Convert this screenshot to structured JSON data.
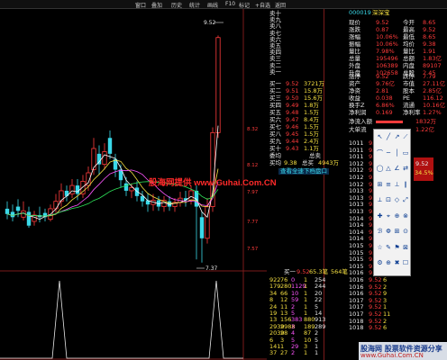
{
  "toolbar": {
    "items": [
      "窗口",
      "叠加",
      "历史",
      "统计",
      "画线",
      "F10",
      "标记",
      "+自选",
      "返回"
    ]
  },
  "chart": {
    "top_price": "9.52",
    "bottom_price": "7.37",
    "price_axis_labels": [
      "8.32",
      "8.12",
      "7.97",
      "7.77",
      "7.57"
    ],
    "watermark": "股海网提供 www.Guhai.Com.CN"
  },
  "ask_labels": [
    "卖十",
    "卖九",
    "卖八",
    "卖七",
    "卖六",
    "卖五",
    "卖四",
    "卖三",
    "卖二",
    "卖一"
  ],
  "bid_labels": [
    "买一",
    "买二",
    "买三",
    "买四",
    "买五",
    "买六",
    "买七",
    "买八",
    "买九",
    "买十"
  ],
  "bids": [
    {
      "price": "9.52",
      "vol": "3721万"
    },
    {
      "price": "9.51",
      "vol": "15.8万"
    },
    {
      "price": "9.50",
      "vol": "15.6万"
    },
    {
      "price": "9.49",
      "vol": "1.8万"
    },
    {
      "price": "9.48",
      "vol": "1.5万"
    },
    {
      "price": "9.47",
      "vol": "8.4万"
    },
    {
      "price": "9.46",
      "vol": "1.5万"
    },
    {
      "price": "9.45",
      "vol": "1.5万"
    },
    {
      "price": "9.44",
      "vol": "2.4万"
    },
    {
      "price": "9.43",
      "vol": "1.1万"
    }
  ],
  "order_summary": {
    "avg_label": "委均",
    "total_label": "总卖",
    "buy_avg_label": "买均",
    "buy_avg": "9.38",
    "buy_total_label": "总买",
    "buy_total": "4943万",
    "button": "查看全速下档盘口"
  },
  "bottom_left": {
    "label": "买一",
    "price": "9.52",
    "unit": "65.3笔",
    "count": "564笔",
    "rows": [
      [
        "922",
        "76",
        "0",
        "1",
        "254"
      ],
      [
        "179",
        "280",
        "1129",
        "1",
        "244"
      ],
      [
        "34",
        "66",
        "10",
        "1",
        "20"
      ],
      [
        "8",
        "12",
        "59",
        "1",
        "22"
      ],
      [
        "24",
        "11",
        "2",
        "1",
        "5"
      ],
      [
        "19",
        "13",
        "5",
        "1",
        "14"
      ],
      [
        "13",
        "156",
        "383",
        "880",
        "913"
      ],
      [
        "2939",
        "2988",
        "3",
        "189",
        "289"
      ],
      [
        "2039",
        "28",
        "4",
        "87",
        "2"
      ],
      [
        "6",
        "3",
        "5",
        "10",
        "5"
      ],
      [
        "141",
        "1",
        "29",
        "3",
        "1"
      ],
      [
        "37",
        "27",
        "2",
        "1",
        "1"
      ]
    ]
  },
  "stock": {
    "code": "000019",
    "name": "深深宝"
  },
  "quote_rows": [
    {
      "l": "现价",
      "v": "9.52",
      "l2": "今开",
      "v2": "8.65"
    },
    {
      "l": "涨跌",
      "v": "0.87",
      "l2": "最高",
      "v2": "9.52"
    },
    {
      "l": "涨幅",
      "v": "10.06%",
      "l2": "最低",
      "v2": "8.65"
    },
    {
      "l": "振幅",
      "v": "10.06%",
      "l2": "均价",
      "v2": "9.38"
    },
    {
      "l": "量比",
      "v": "7.98%",
      "l2": "量比",
      "v2": "1.91"
    },
    {
      "l": "总量",
      "v": "195496",
      "l2": "总额",
      "v2": "1.83亿"
    },
    {
      "l": "外盘",
      "v": "106389",
      "l2": "内盘",
      "v2": "89107"
    },
    {
      "l": "升盘",
      "v": "102658",
      "l2": "总股",
      "v2": "2.45"
    }
  ],
  "finance_rows": [
    {
      "l": "涨停",
      "v": "9.52",
      "l2": "跌停",
      "v2": "7.79"
    },
    {
      "l": "资产",
      "v": "9.76亿",
      "l2": "市值",
      "v2": "27.11亿"
    },
    {
      "l": "净资",
      "v": "2.81",
      "l2": "股本",
      "v2": "2.85亿"
    },
    {
      "l": "收益",
      "v": "0.038",
      "l2": "PE",
      "v2": "116.12"
    },
    {
      "l": "换手Z",
      "v": "6.86%",
      "l2": "流通",
      "v2": "10.16亿"
    },
    {
      "l": "净利润",
      "v": "0.169",
      "l2": "净利率",
      "v2": "1.27%"
    }
  ],
  "flow": {
    "in_label": "净流入额",
    "in_value": "1832万",
    "big_label": "大单流",
    "big_value": "1.22亿"
  },
  "ticks": [
    {
      "t": "1011",
      "p": "9.52",
      "v": "2"
    },
    {
      "t": "1011",
      "p": "9.52",
      "v": "5"
    },
    {
      "t": "1011",
      "p": "9.52",
      "v": "20"
    },
    {
      "t": "1012",
      "p": "9.52",
      "v": "3"
    },
    {
      "t": "1012",
      "p": "9.52",
      "v": "9"
    },
    {
      "t": "1012",
      "p": "9.52",
      "v": "1"
    },
    {
      "t": "1012",
      "p": "9.52",
      "v": "12"
    },
    {
      "t": "1013",
      "p": "9.52",
      "v": "6"
    },
    {
      "t": "1013",
      "p": "9.52",
      "v": "4"
    },
    {
      "t": "1013",
      "p": "9.52",
      "v": "8"
    },
    {
      "t": "1013",
      "p": "9.52",
      "v": "2"
    },
    {
      "t": "1014",
      "p": "9.52",
      "v": "1"
    },
    {
      "t": "1014",
      "p": "9.52",
      "v": "15"
    },
    {
      "t": "1014",
      "p": "9.52",
      "v": "3"
    },
    {
      "t": "1014",
      "p": "9.52",
      "v": "7"
    },
    {
      "t": "1015",
      "p": "9.52",
      "v": "2"
    },
    {
      "t": "1015",
      "p": "9.52",
      "v": "10"
    },
    {
      "t": "1015",
      "p": "9.52",
      "v": "5"
    },
    {
      "t": "1015",
      "p": "9.52",
      "v": "1"
    },
    {
      "t": "1016",
      "p": "9.52",
      "v": "4"
    },
    {
      "t": "1016",
      "p": "9.52",
      "v": "6"
    },
    {
      "t": "1016",
      "p": "9.52",
      "v": "2"
    },
    {
      "t": "1016",
      "p": "9.52",
      "v": "9"
    },
    {
      "t": "1017",
      "p": "9.52",
      "v": "3"
    },
    {
      "t": "1017",
      "p": "9.52",
      "v": "1"
    },
    {
      "t": "1017",
      "p": "9.52",
      "v": "11"
    },
    {
      "t": "1018",
      "p": "9.52",
      "v": "2"
    },
    {
      "t": "1018",
      "p": "9.52",
      "v": "6"
    }
  ],
  "side_badges": [
    "9.52",
    "34.5%"
  ],
  "logo": {
    "line1": "股海网 股票软件资源分享",
    "line2": "www.Guhai.Com.CN"
  },
  "colors": {
    "up": "#ff3b3b",
    "down": "#3ad8e8",
    "ma5": "#ffffff",
    "ma10": "#f5e042",
    "ma20": "#ff55ff",
    "ma60": "#2ee55a"
  }
}
